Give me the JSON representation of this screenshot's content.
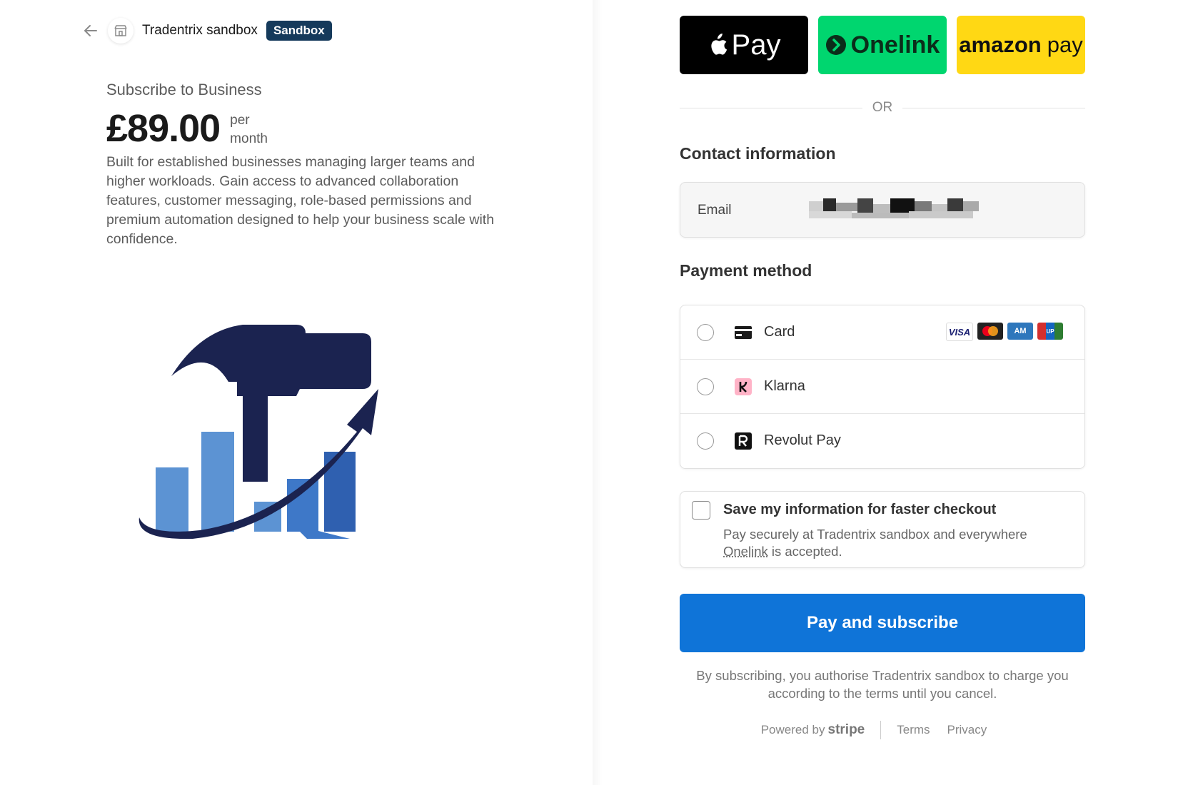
{
  "header": {
    "merchant_name": "Tradentrix sandbox",
    "badge": "Sandbox"
  },
  "product": {
    "title": "Subscribe to Business",
    "price": "£89.00",
    "period_line1": "per",
    "period_line2": "month",
    "description": "Built for established businesses managing larger teams and higher workloads. Gain access to advanced collaboration features, customer messaging, role-based permissions and premium automation designed to help your business scale with confidence."
  },
  "wallets": {
    "apple_pay": "Pay",
    "onelink": "Onelink",
    "amazon_pay_1": "amazon",
    "amazon_pay_2": "pay"
  },
  "divider": "OR",
  "contact": {
    "title": "Contact information",
    "email_label": "Email"
  },
  "payment": {
    "title": "Payment method",
    "methods": [
      {
        "label": "Card",
        "icon": "card-icon"
      },
      {
        "label": "Klarna",
        "icon": "klarna-icon"
      },
      {
        "label": "Revolut Pay",
        "icon": "revolut-icon"
      }
    ],
    "brands": [
      "VISA",
      "",
      "AM",
      "UP"
    ]
  },
  "save": {
    "title": "Save my information for faster checkout",
    "text_before": "Pay securely at Tradentrix sandbox and everywhere ",
    "link": "Onelink",
    "text_after": " is accepted."
  },
  "pay_button": "Pay and subscribe",
  "legal": "By subscribing, you authorise Tradentrix sandbox to charge you according to the terms until you cancel.",
  "footer": {
    "powered_by": "Powered by",
    "stripe": "stripe",
    "terms": "Terms",
    "privacy": "Privacy"
  },
  "colors": {
    "primary": "#0f74d8",
    "badge": "#153a5b",
    "onelink": "#00d66f",
    "amazon": "#ffd814",
    "logo_navy": "#1b2350",
    "logo_blue": "#3e78c8"
  }
}
